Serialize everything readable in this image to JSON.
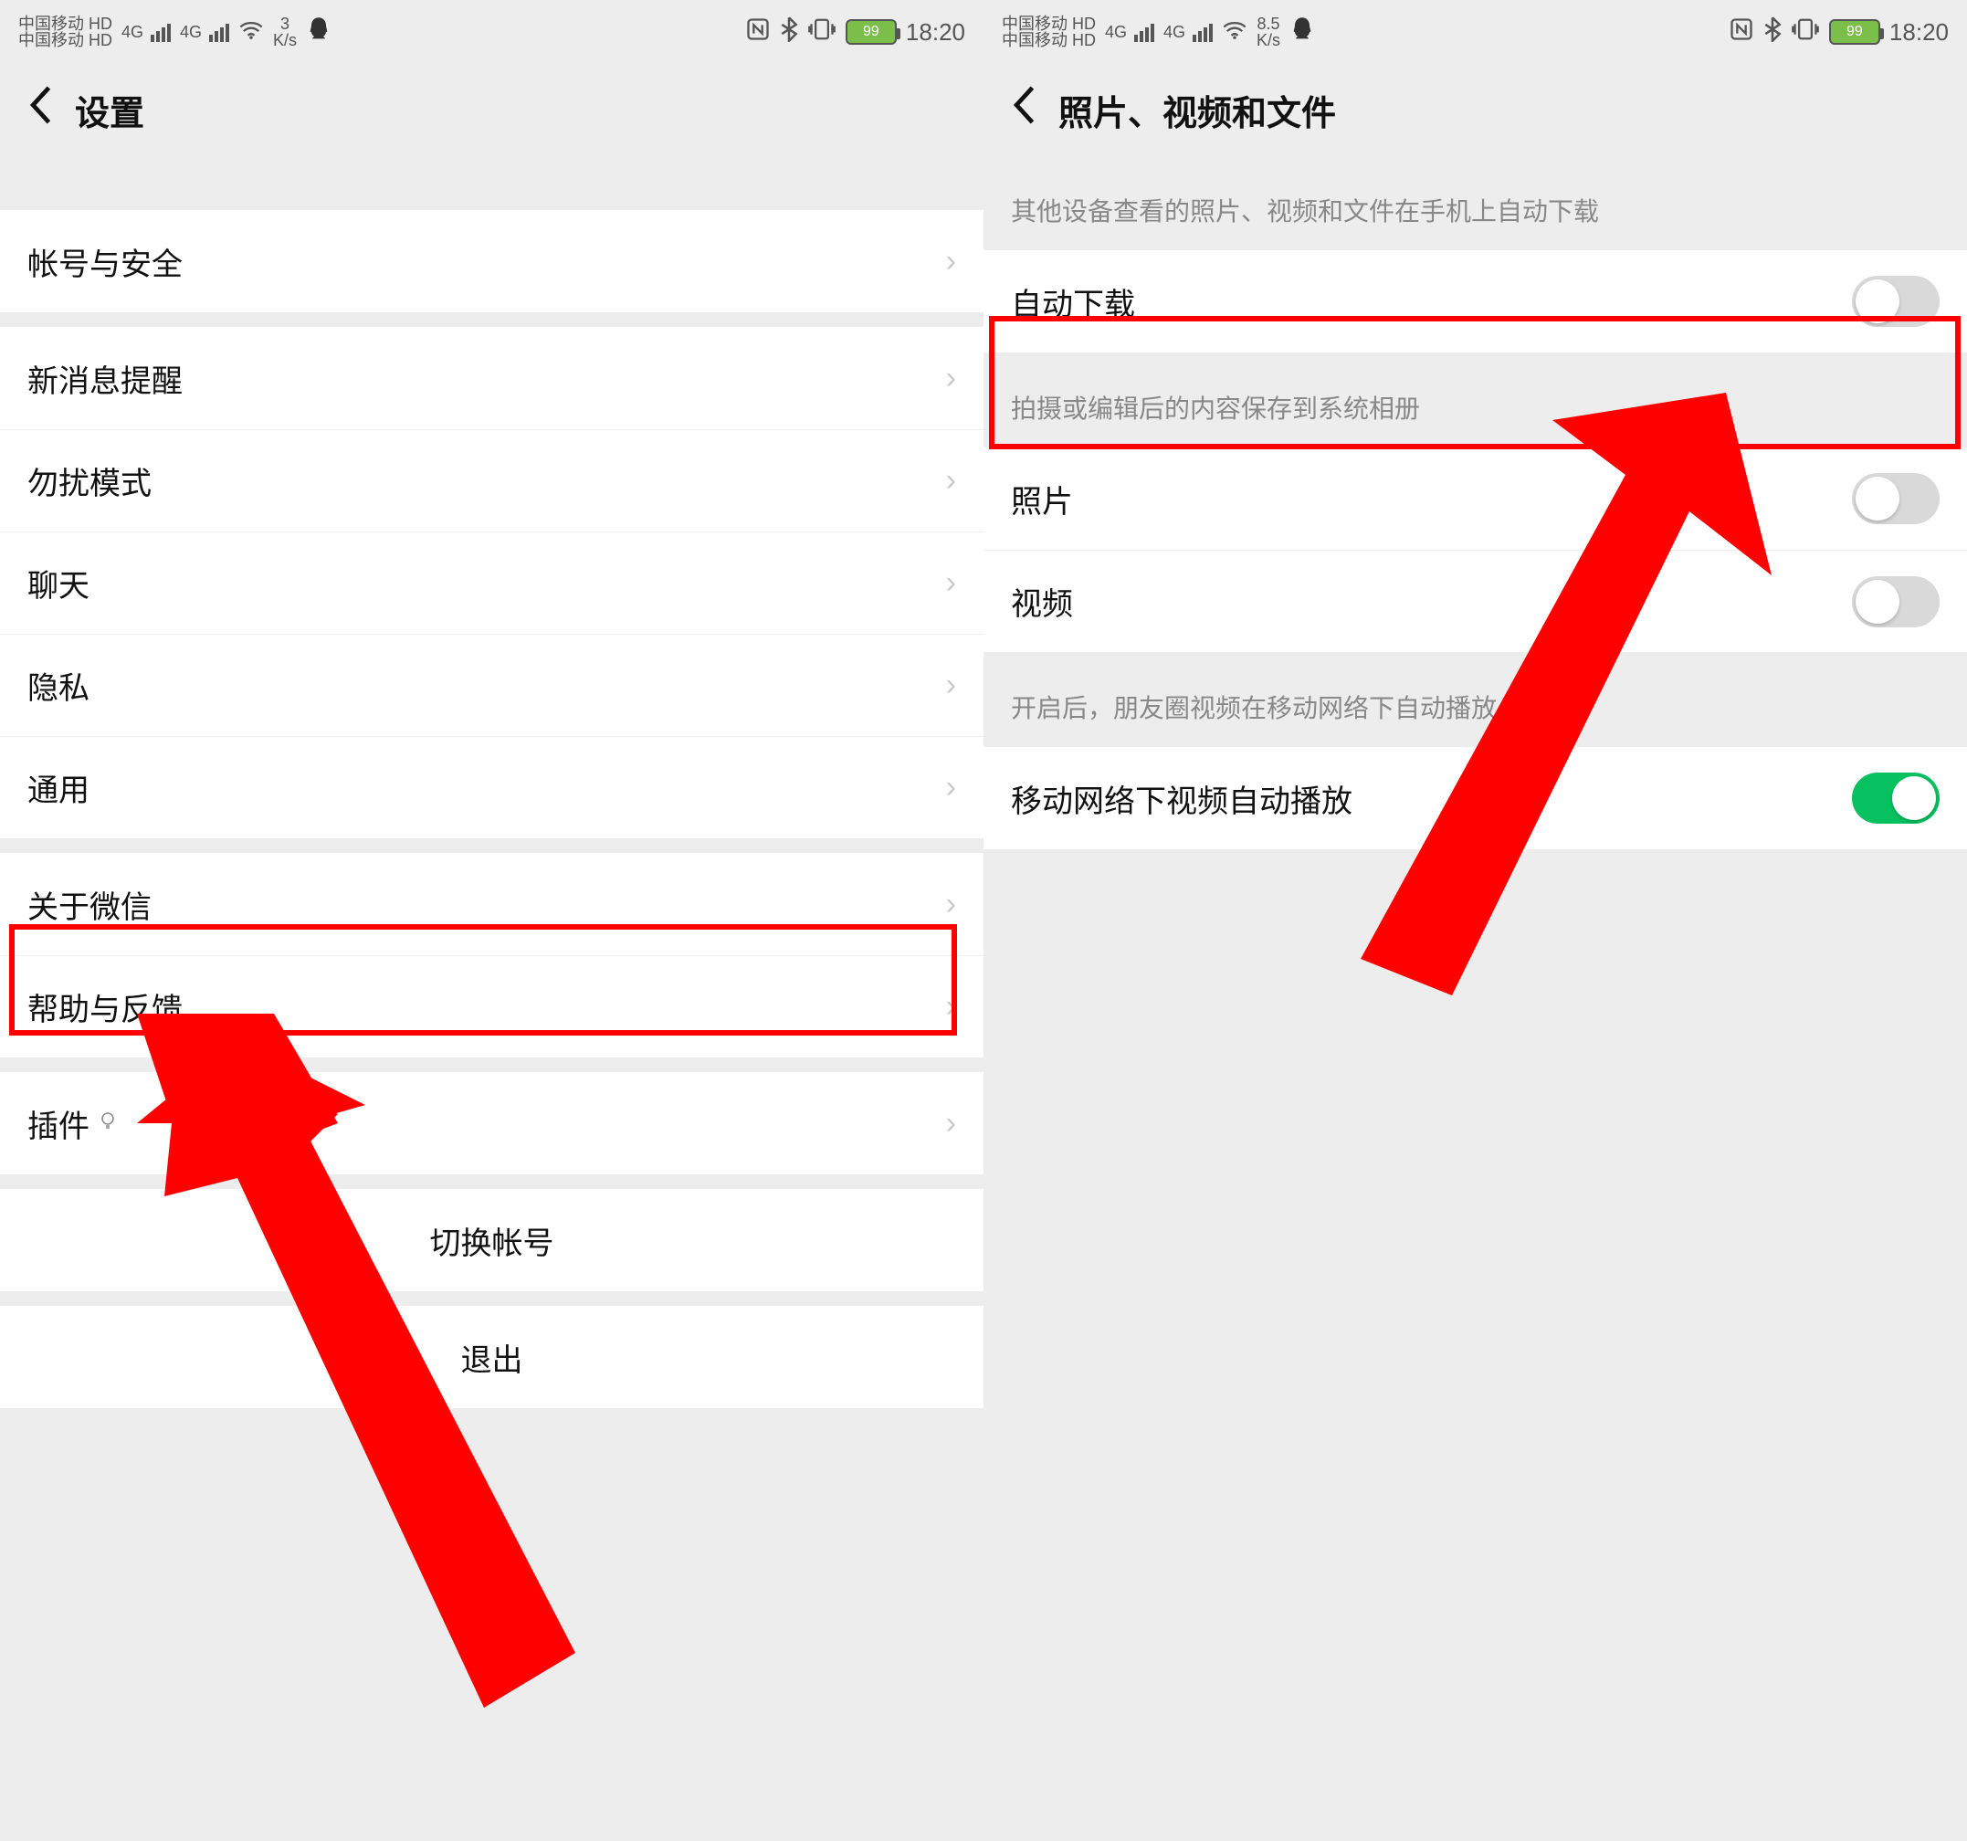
{
  "status": {
    "carrier": "中国移动",
    "hd": "HD",
    "net": "4G",
    "battery": "99",
    "time": "18:20"
  },
  "left": {
    "title": "设置",
    "speed": {
      "num": "3",
      "unit": "K/s"
    },
    "items": {
      "account": "帐号与安全",
      "notify": "新消息提醒",
      "dnd": "勿扰模式",
      "chat": "聊天",
      "privacy": "隐私",
      "general": "通用",
      "about": "关于微信",
      "help": "帮助与反馈",
      "plugin": "插件",
      "switch": "切换帐号",
      "logout": "退出"
    }
  },
  "right": {
    "title": "照片、视频和文件",
    "speed": {
      "num": "8.5",
      "unit": "K/s"
    },
    "sections": {
      "autodl_label": "其他设备查看的照片、视频和文件在手机上自动下载",
      "autodl": "自动下载",
      "save_label": "拍摄或编辑后的内容保存到系统相册",
      "photo": "照片",
      "video": "视频",
      "autoplay_label": "开启后，朋友圈视频在移动网络下自动播放",
      "autoplay": "移动网络下视频自动播放"
    }
  }
}
